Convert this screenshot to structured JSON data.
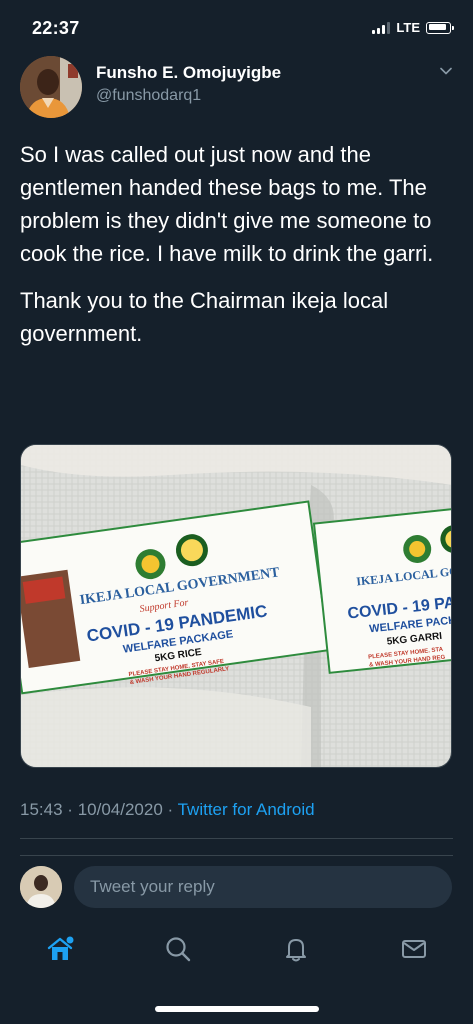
{
  "status_bar": {
    "time": "22:37",
    "network": "LTE",
    "icons": [
      "signal-icon",
      "battery-icon"
    ]
  },
  "tweet": {
    "author": {
      "name": "Funsho E. Omojuyigbe",
      "handle": "@funshodarq1",
      "avatar_icon": "avatar"
    },
    "text": [
      "So I was called out just now and the gentlemen handed these bags to me. The problem is they didn't give me someone to cook the rice. I have milk to drink the garri.",
      "Thank you to the Chairman ikeja local government."
    ],
    "photo": {
      "bag_left": {
        "title": "IKEJA LOCAL GOVERNMENT",
        "support": "Support For",
        "headline": "COVID - 19 PANDEMIC",
        "package": "WELFARE PACKAGE",
        "item": "5KG RICE",
        "slogan_1": "PLEASE STAY HOME. STAY SAFE",
        "slogan_2": "& WASH YOUR HAND REGULARLY"
      },
      "bag_right": {
        "title": "IKEJA LOCAL GO",
        "headline": "COVID - 19 PAN",
        "package": "WELFARE PACK",
        "item": "5KG GARRI",
        "slogan_1": "PLEASE STAY HOME. STA",
        "slogan_2": "& WASH YOUR HAND REG"
      }
    },
    "time": "15:43",
    "separator": "·",
    "date": "10/04/2020",
    "source": "Twitter for Android"
  },
  "reply": {
    "placeholder": "Tweet your reply"
  },
  "tab_bar": {
    "tabs": [
      "home-icon",
      "search-icon",
      "notifications-icon",
      "messages-icon"
    ],
    "active": "home-icon"
  },
  "colors": {
    "background": "#15202b",
    "accent": "#1da1f2",
    "secondary_text": "#8899a6",
    "divider": "#38444d"
  }
}
